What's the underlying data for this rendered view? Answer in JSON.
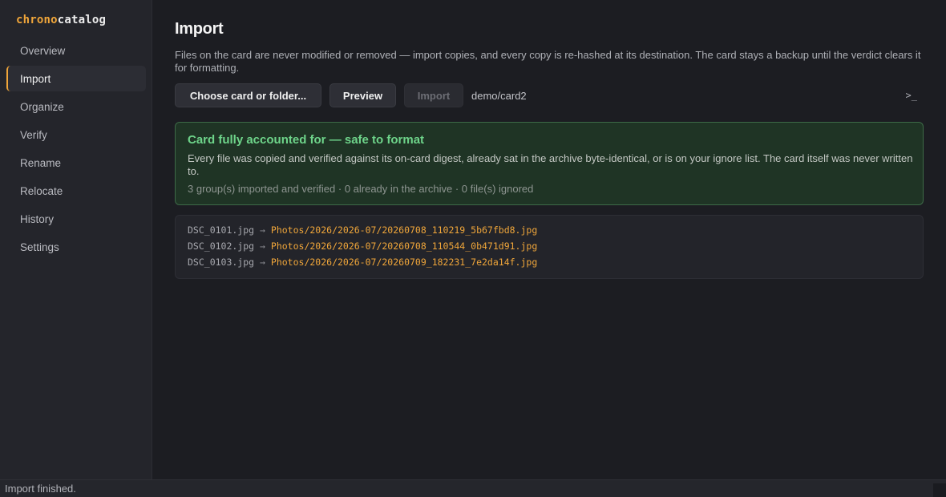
{
  "app": {
    "brand_part1": "chrono",
    "brand_part2": "catalog"
  },
  "sidebar": {
    "items": [
      {
        "label": "Overview"
      },
      {
        "label": "Import",
        "active": true
      },
      {
        "label": "Organize"
      },
      {
        "label": "Verify"
      },
      {
        "label": "Rename"
      },
      {
        "label": "Relocate"
      },
      {
        "label": "History"
      },
      {
        "label": "Settings"
      }
    ]
  },
  "main": {
    "title": "Import",
    "description": "Files on the card are never modified or removed — import copies, and every copy is re-hashed at its destination. The card stays a backup until the verdict clears it for formatting."
  },
  "toolbar": {
    "choose_label": "Choose card or folder...",
    "preview_label": "Preview",
    "import_label": "Import",
    "import_enabled": false,
    "selected_path": "demo/card2",
    "terminal_icon": ">_"
  },
  "verdict": {
    "title": "Card fully accounted for — safe to format",
    "body": "Every file was copied and verified against its on-card digest, already sat in the archive byte-identical, or is on your ignore list. The card itself was never written to.",
    "summary": "3 group(s) imported and verified · 0 already in the archive · 0 file(s) ignored",
    "status_color": "#6ed48a"
  },
  "log": {
    "arrow": "→",
    "rows": [
      {
        "source": "DSC_0101.jpg",
        "dest": "Photos/2026/2026-07/20260708_110219_5b67fbd8.jpg"
      },
      {
        "source": "DSC_0102.jpg",
        "dest": "Photos/2026/2026-07/20260708_110544_0b471d91.jpg"
      },
      {
        "source": "DSC_0103.jpg",
        "dest": "Photos/2026/2026-07/20260709_182231_7e2da14f.jpg"
      }
    ]
  },
  "status": {
    "text": "Import finished."
  },
  "colors": {
    "accent": "#f0a63a",
    "background": "#1c1d22",
    "sidebar": "#24252b"
  }
}
